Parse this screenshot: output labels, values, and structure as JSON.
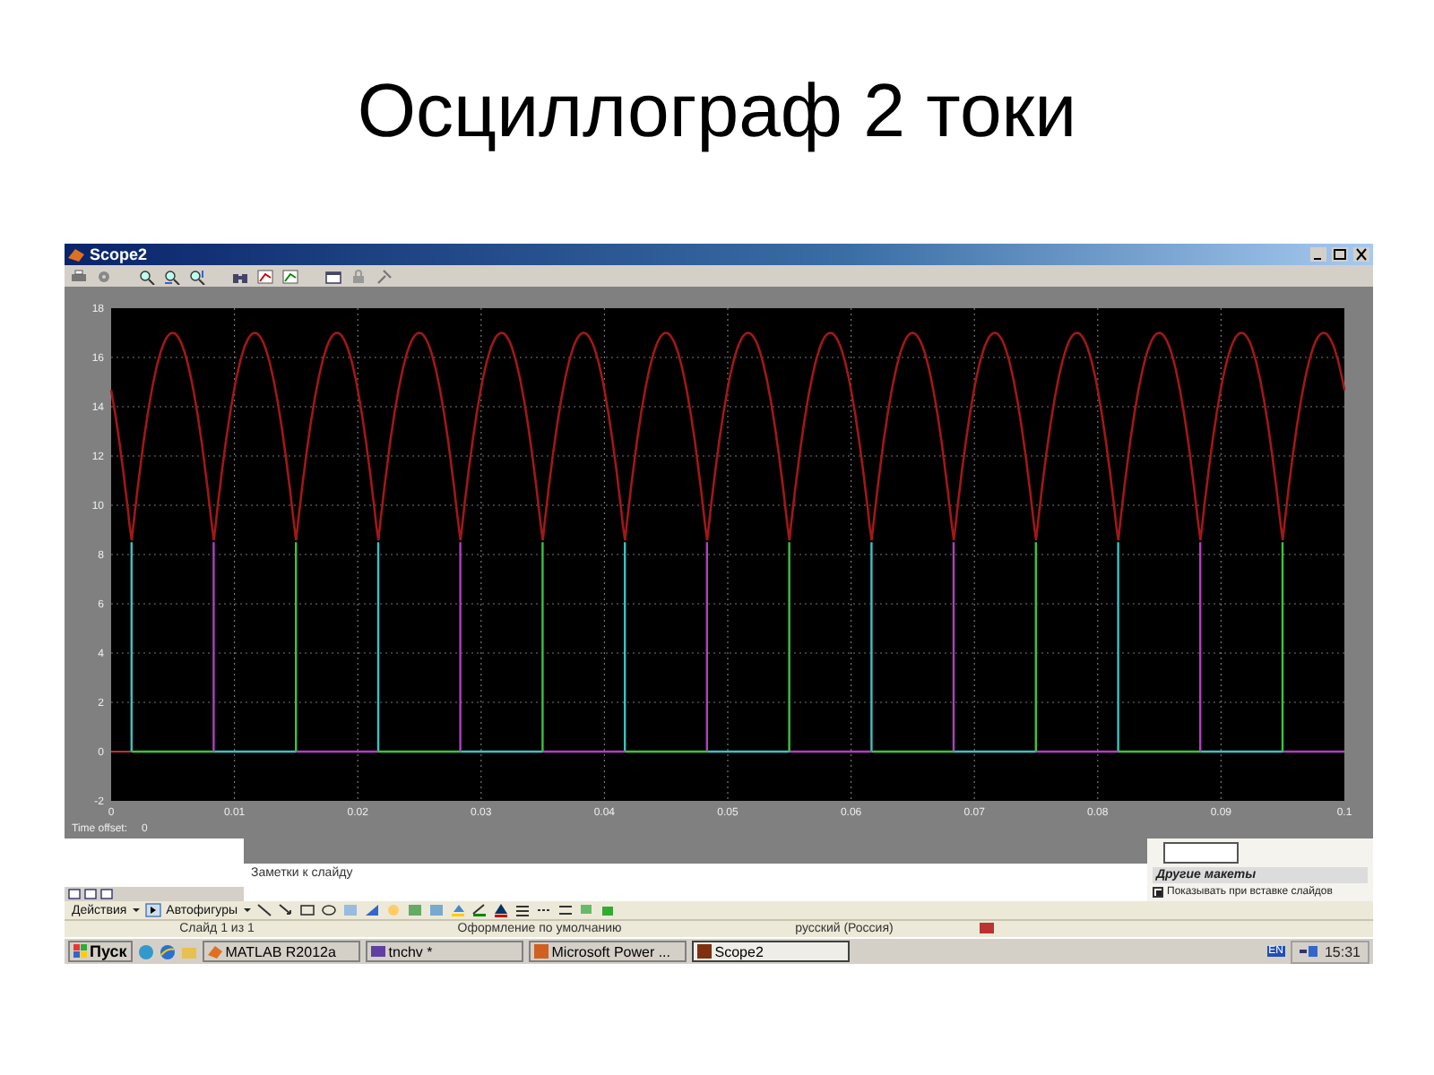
{
  "slide": {
    "title": "Осциллограф 2 токи"
  },
  "scope_window": {
    "title": "Scope2",
    "y_axis_labels": [
      "18",
      "16",
      "14",
      "12",
      "10",
      "8",
      "6",
      "4",
      "2",
      "0",
      "-2"
    ],
    "x_axis_labels": [
      "0",
      "0.01",
      "0.02",
      "0.03",
      "0.04",
      "0.05",
      "0.06",
      "0.07",
      "0.08",
      "0.09",
      "0.1"
    ],
    "time_offset_label": "Time offset:",
    "time_offset_value": "0"
  },
  "notes_pane": {
    "placeholder": "Заметки к слайду"
  },
  "layout_panel": {
    "label": "Другие макеты",
    "show_on_insert": {
      "label": "Показывать при вставке слайдов",
      "checked": true
    }
  },
  "drawing_toolbar": {
    "actions": "Действия",
    "autoshapes": "Автофигуры"
  },
  "status_bar": [
    "Слайд 1 из 1",
    "Оформление по умолчанию",
    "русский (Россия)"
  ],
  "taskbar": {
    "start": "Пуск",
    "tasks": [
      {
        "label": "MATLAB  R2012a",
        "selected": false
      },
      {
        "label": "tnchv *",
        "selected": false
      },
      {
        "label": "Microsoft Power ...",
        "selected": false
      },
      {
        "label": "Scope2",
        "selected": true
      }
    ],
    "language": "EN",
    "clock": "15:31"
  }
}
